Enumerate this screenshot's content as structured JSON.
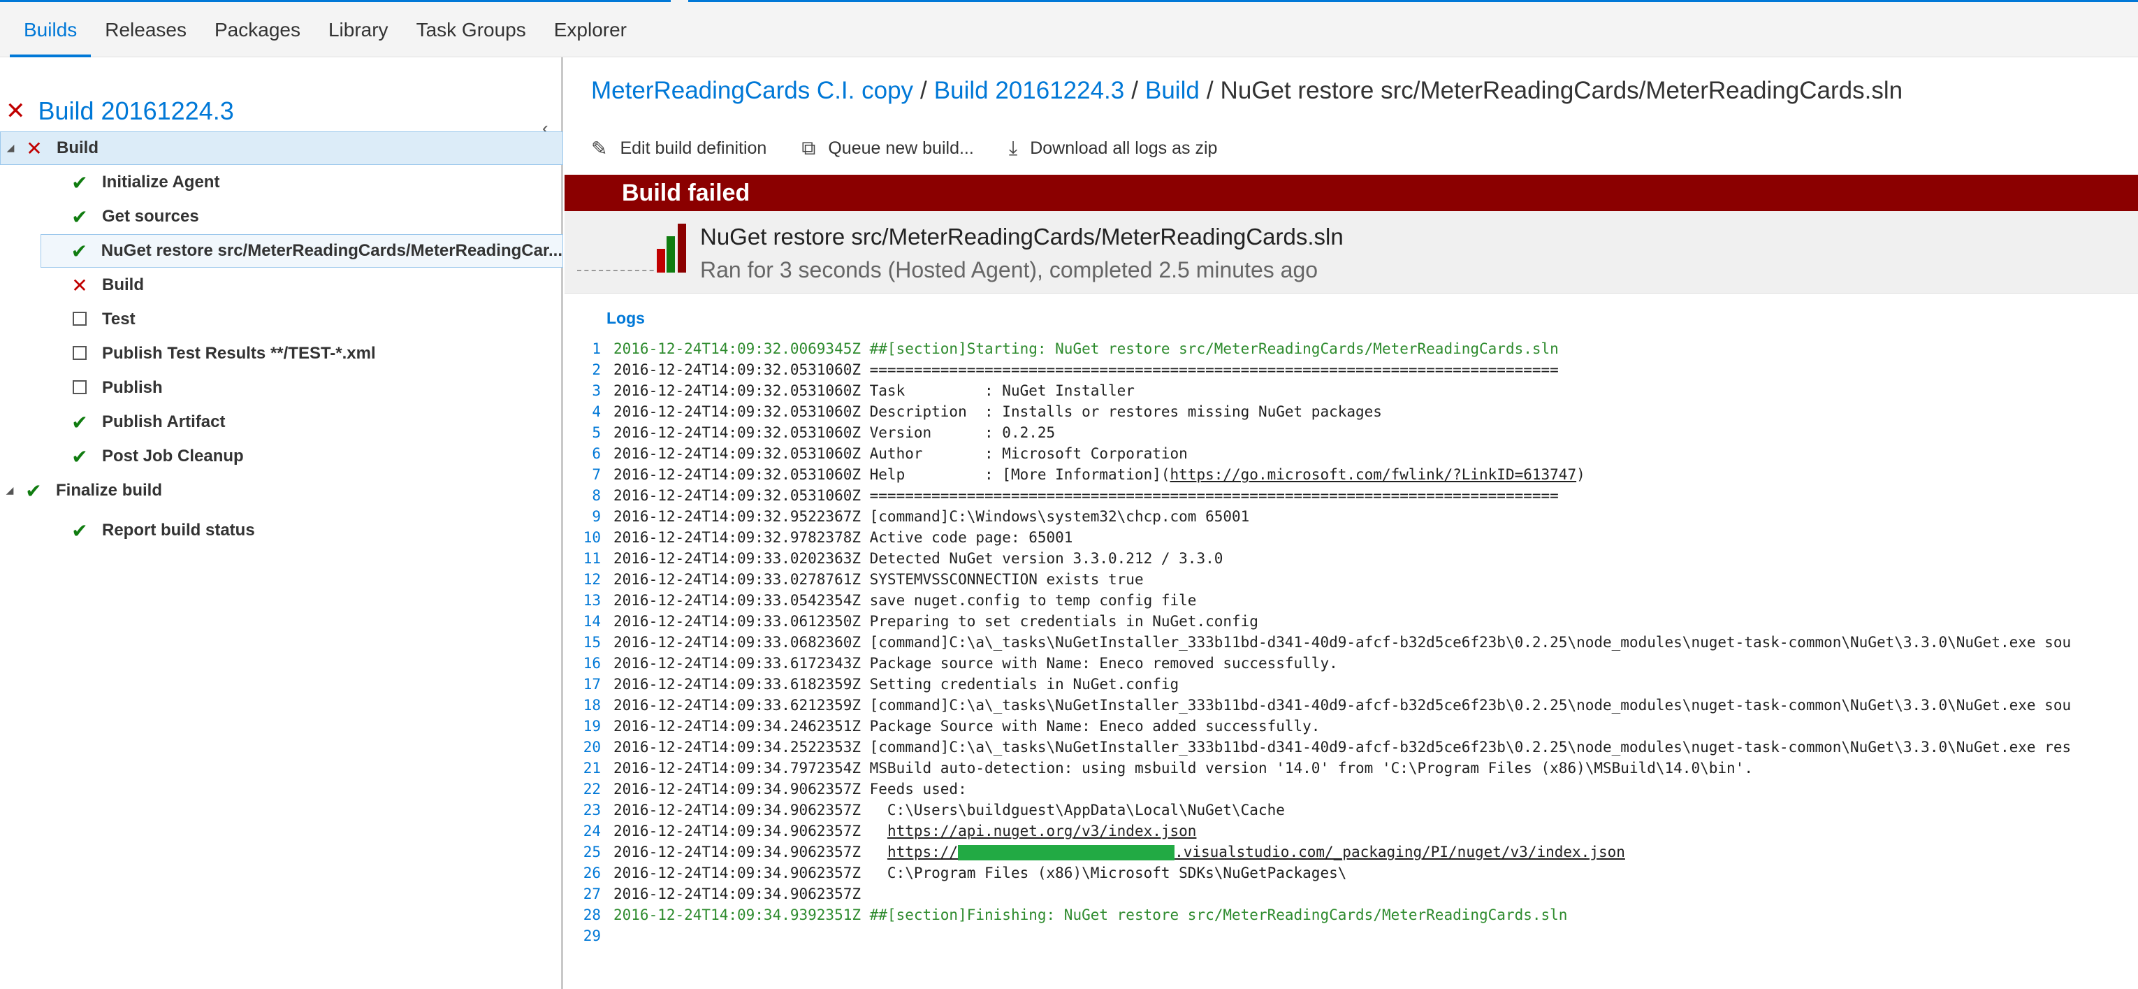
{
  "nav": {
    "tabs": [
      {
        "label": "Builds",
        "active": true
      },
      {
        "label": "Releases"
      },
      {
        "label": "Packages"
      },
      {
        "label": "Library"
      },
      {
        "label": "Task Groups"
      },
      {
        "label": "Explorer"
      }
    ]
  },
  "sidebar": {
    "collapse": "‹",
    "build_title": "Build 20161224.3",
    "build_status": "failed",
    "items": [
      {
        "label": "Build",
        "status": "failed",
        "level": 0
      },
      {
        "label": "Initialize Agent",
        "status": "succeeded",
        "level": 1
      },
      {
        "label": "Get sources",
        "status": "succeeded",
        "level": 1
      },
      {
        "label": "NuGet restore src/MeterReadingCards/MeterReadingCar...",
        "status": "succeeded",
        "level": 1
      },
      {
        "label": "Build",
        "status": "failed",
        "level": 1
      },
      {
        "label": "Test",
        "status": "skipped",
        "level": 1
      },
      {
        "label": "Publish Test Results **/TEST-*.xml",
        "status": "skipped",
        "level": 1
      },
      {
        "label": "Publish",
        "status": "skipped",
        "level": 1
      },
      {
        "label": "Publish Artifact",
        "status": "succeeded",
        "level": 1
      },
      {
        "label": "Post Job Cleanup",
        "status": "succeeded",
        "level": 1
      },
      {
        "label": "Finalize build",
        "status": "succeeded",
        "level": 0
      },
      {
        "label": "Report build status",
        "status": "succeeded",
        "level": 1
      }
    ]
  },
  "breadcrumb": {
    "definition": "MeterReadingCards C.I. copy",
    "build": "Build 20161224.3",
    "phase": "Build",
    "current": "NuGet restore src/MeterReadingCards/MeterReadingCards.sln",
    "sep": "/"
  },
  "toolbar": {
    "edit": "Edit build definition",
    "queue": "Queue new build...",
    "download": "Download all logs as zip"
  },
  "banner": {
    "text": "Build failed",
    "color": "#8b0000"
  },
  "task": {
    "name": "NuGet restore src/MeterReadingCards/MeterReadingCards.sln",
    "status": "Ran for 3 seconds (Hosted Agent), completed 2.5 minutes ago"
  },
  "logs": {
    "title": "Logs",
    "lines": [
      {
        "n": "1",
        "t": "2016-12-24T14:09:32.0069345Z ##[section]Starting: NuGet restore src/MeterReadingCards/MeterReadingCards.sln",
        "section": true
      },
      {
        "n": "2",
        "t": "2016-12-24T14:09:32.0531060Z =============================================================================="
      },
      {
        "n": "3",
        "t": "2016-12-24T14:09:32.0531060Z Task         : NuGet Installer"
      },
      {
        "n": "4",
        "t": "2016-12-24T14:09:32.0531060Z Description  : Installs or restores missing NuGet packages"
      },
      {
        "n": "5",
        "t": "2016-12-24T14:09:32.0531060Z Version      : 0.2.25"
      },
      {
        "n": "6",
        "t": "2016-12-24T14:09:32.0531060Z Author       : Microsoft Corporation"
      },
      {
        "n": "7",
        "t": "2016-12-24T14:09:32.0531060Z Help         : [More Information](",
        "link": "https://go.microsoft.com/fwlink/?LinkID=613747",
        "after": ")"
      },
      {
        "n": "8",
        "t": "2016-12-24T14:09:32.0531060Z =============================================================================="
      },
      {
        "n": "9",
        "t": "2016-12-24T14:09:32.9522367Z [command]C:\\Windows\\system32\\chcp.com 65001"
      },
      {
        "n": "10",
        "t": "2016-12-24T14:09:32.9782378Z Active code page: 65001"
      },
      {
        "n": "11",
        "t": "2016-12-24T14:09:33.0202363Z Detected NuGet version 3.3.0.212 / 3.3.0"
      },
      {
        "n": "12",
        "t": "2016-12-24T14:09:33.0278761Z SYSTEMVSSCONNECTION exists true"
      },
      {
        "n": "13",
        "t": "2016-12-24T14:09:33.0542354Z save nuget.config to temp config file"
      },
      {
        "n": "14",
        "t": "2016-12-24T14:09:33.0612350Z Preparing to set credentials in NuGet.config"
      },
      {
        "n": "15",
        "t": "2016-12-24T14:09:33.0682360Z [command]C:\\a\\_tasks\\NuGetInstaller_333b11bd-d341-40d9-afcf-b32d5ce6f23b\\0.2.25\\node_modules\\nuget-task-common\\NuGet\\3.3.0\\NuGet.exe sou"
      },
      {
        "n": "16",
        "t": "2016-12-24T14:09:33.6172343Z Package source with Name: Eneco removed successfully."
      },
      {
        "n": "17",
        "t": "2016-12-24T14:09:33.6182359Z Setting credentials in NuGet.config"
      },
      {
        "n": "18",
        "t": "2016-12-24T14:09:33.6212359Z [command]C:\\a\\_tasks\\NuGetInstaller_333b11bd-d341-40d9-afcf-b32d5ce6f23b\\0.2.25\\node_modules\\nuget-task-common\\NuGet\\3.3.0\\NuGet.exe sou"
      },
      {
        "n": "19",
        "t": "2016-12-24T14:09:34.2462351Z Package Source with Name: Eneco added successfully."
      },
      {
        "n": "20",
        "t": "2016-12-24T14:09:34.2522353Z [command]C:\\a\\_tasks\\NuGetInstaller_333b11bd-d341-40d9-afcf-b32d5ce6f23b\\0.2.25\\node_modules\\nuget-task-common\\NuGet\\3.3.0\\NuGet.exe res"
      },
      {
        "n": "21",
        "t": "2016-12-24T14:09:34.7972354Z MSBuild auto-detection: using msbuild version '14.0' from 'C:\\Program Files (x86)\\MSBuild\\14.0\\bin'."
      },
      {
        "n": "22",
        "t": "2016-12-24T14:09:34.9062357Z Feeds used:"
      },
      {
        "n": "23",
        "t": "2016-12-24T14:09:34.9062357Z   C:\\Users\\buildguest\\AppData\\Local\\NuGet\\Cache"
      },
      {
        "n": "24",
        "t": "2016-12-24T14:09:34.9062357Z   ",
        "link": "https://api.nuget.org/v3/index.json",
        "after": ""
      },
      {
        "n": "25",
        "t": "2016-12-24T14:09:34.9062357Z   ",
        "link": "https://",
        "redacted": true,
        "link2": ".visualstudio.com/_packaging/PI/nuget/v3/index.json"
      },
      {
        "n": "26",
        "t": "2016-12-24T14:09:34.9062357Z   C:\\Program Files (x86)\\Microsoft SDKs\\NuGetPackages\\"
      },
      {
        "n": "27",
        "t": "2016-12-24T14:09:34.9062357Z"
      },
      {
        "n": "28",
        "t": "2016-12-24T14:09:34.9392351Z ##[section]Finishing: NuGet restore src/MeterReadingCards/MeterReadingCards.sln",
        "section": true
      },
      {
        "n": "29",
        "t": ""
      }
    ]
  },
  "icons": {
    "failed": "close-icon",
    "succeeded": "check-icon",
    "skipped": "checkbox-icon",
    "edit": "pencil-icon",
    "queue": "queue-icon",
    "download": "download-icon"
  },
  "colors": {
    "accent": "#0078d7",
    "failed": "#c00000",
    "succeeded": "#107c10",
    "banner": "#8b0000",
    "section_text": "#2e8b2e"
  }
}
